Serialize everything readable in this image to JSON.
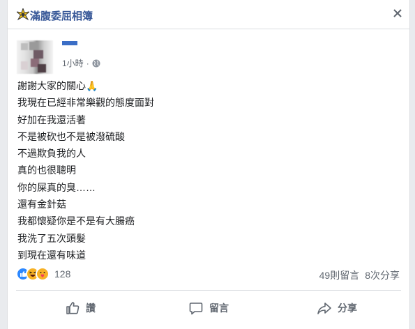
{
  "header": {
    "page_name": "滿腹委屈相簿"
  },
  "post": {
    "timestamp": "1小時",
    "separator": "·",
    "lines": [
      "謝謝大家的關心🙏",
      "我現在已經非常樂觀的態度面對",
      "好加在我還活著",
      "不是被砍也不是被潑硫酸",
      "不過欺負我的人",
      "真的也很聰明",
      "你的屎真的臭……",
      "還有金針菇",
      "我都懷疑你是不是有大腸癌",
      "我洗了五次頭髮",
      "到現在還有味道"
    ]
  },
  "engagement": {
    "reaction_count": "128",
    "comments": "49則留言",
    "shares": "8次分享"
  },
  "actions": {
    "like": "讚",
    "comment": "留言",
    "share": "分享"
  },
  "colors": {
    "link": "#385898",
    "meta": "#606770",
    "like_blue": "#2d88ff",
    "reaction_yellow": "#f7b125"
  }
}
